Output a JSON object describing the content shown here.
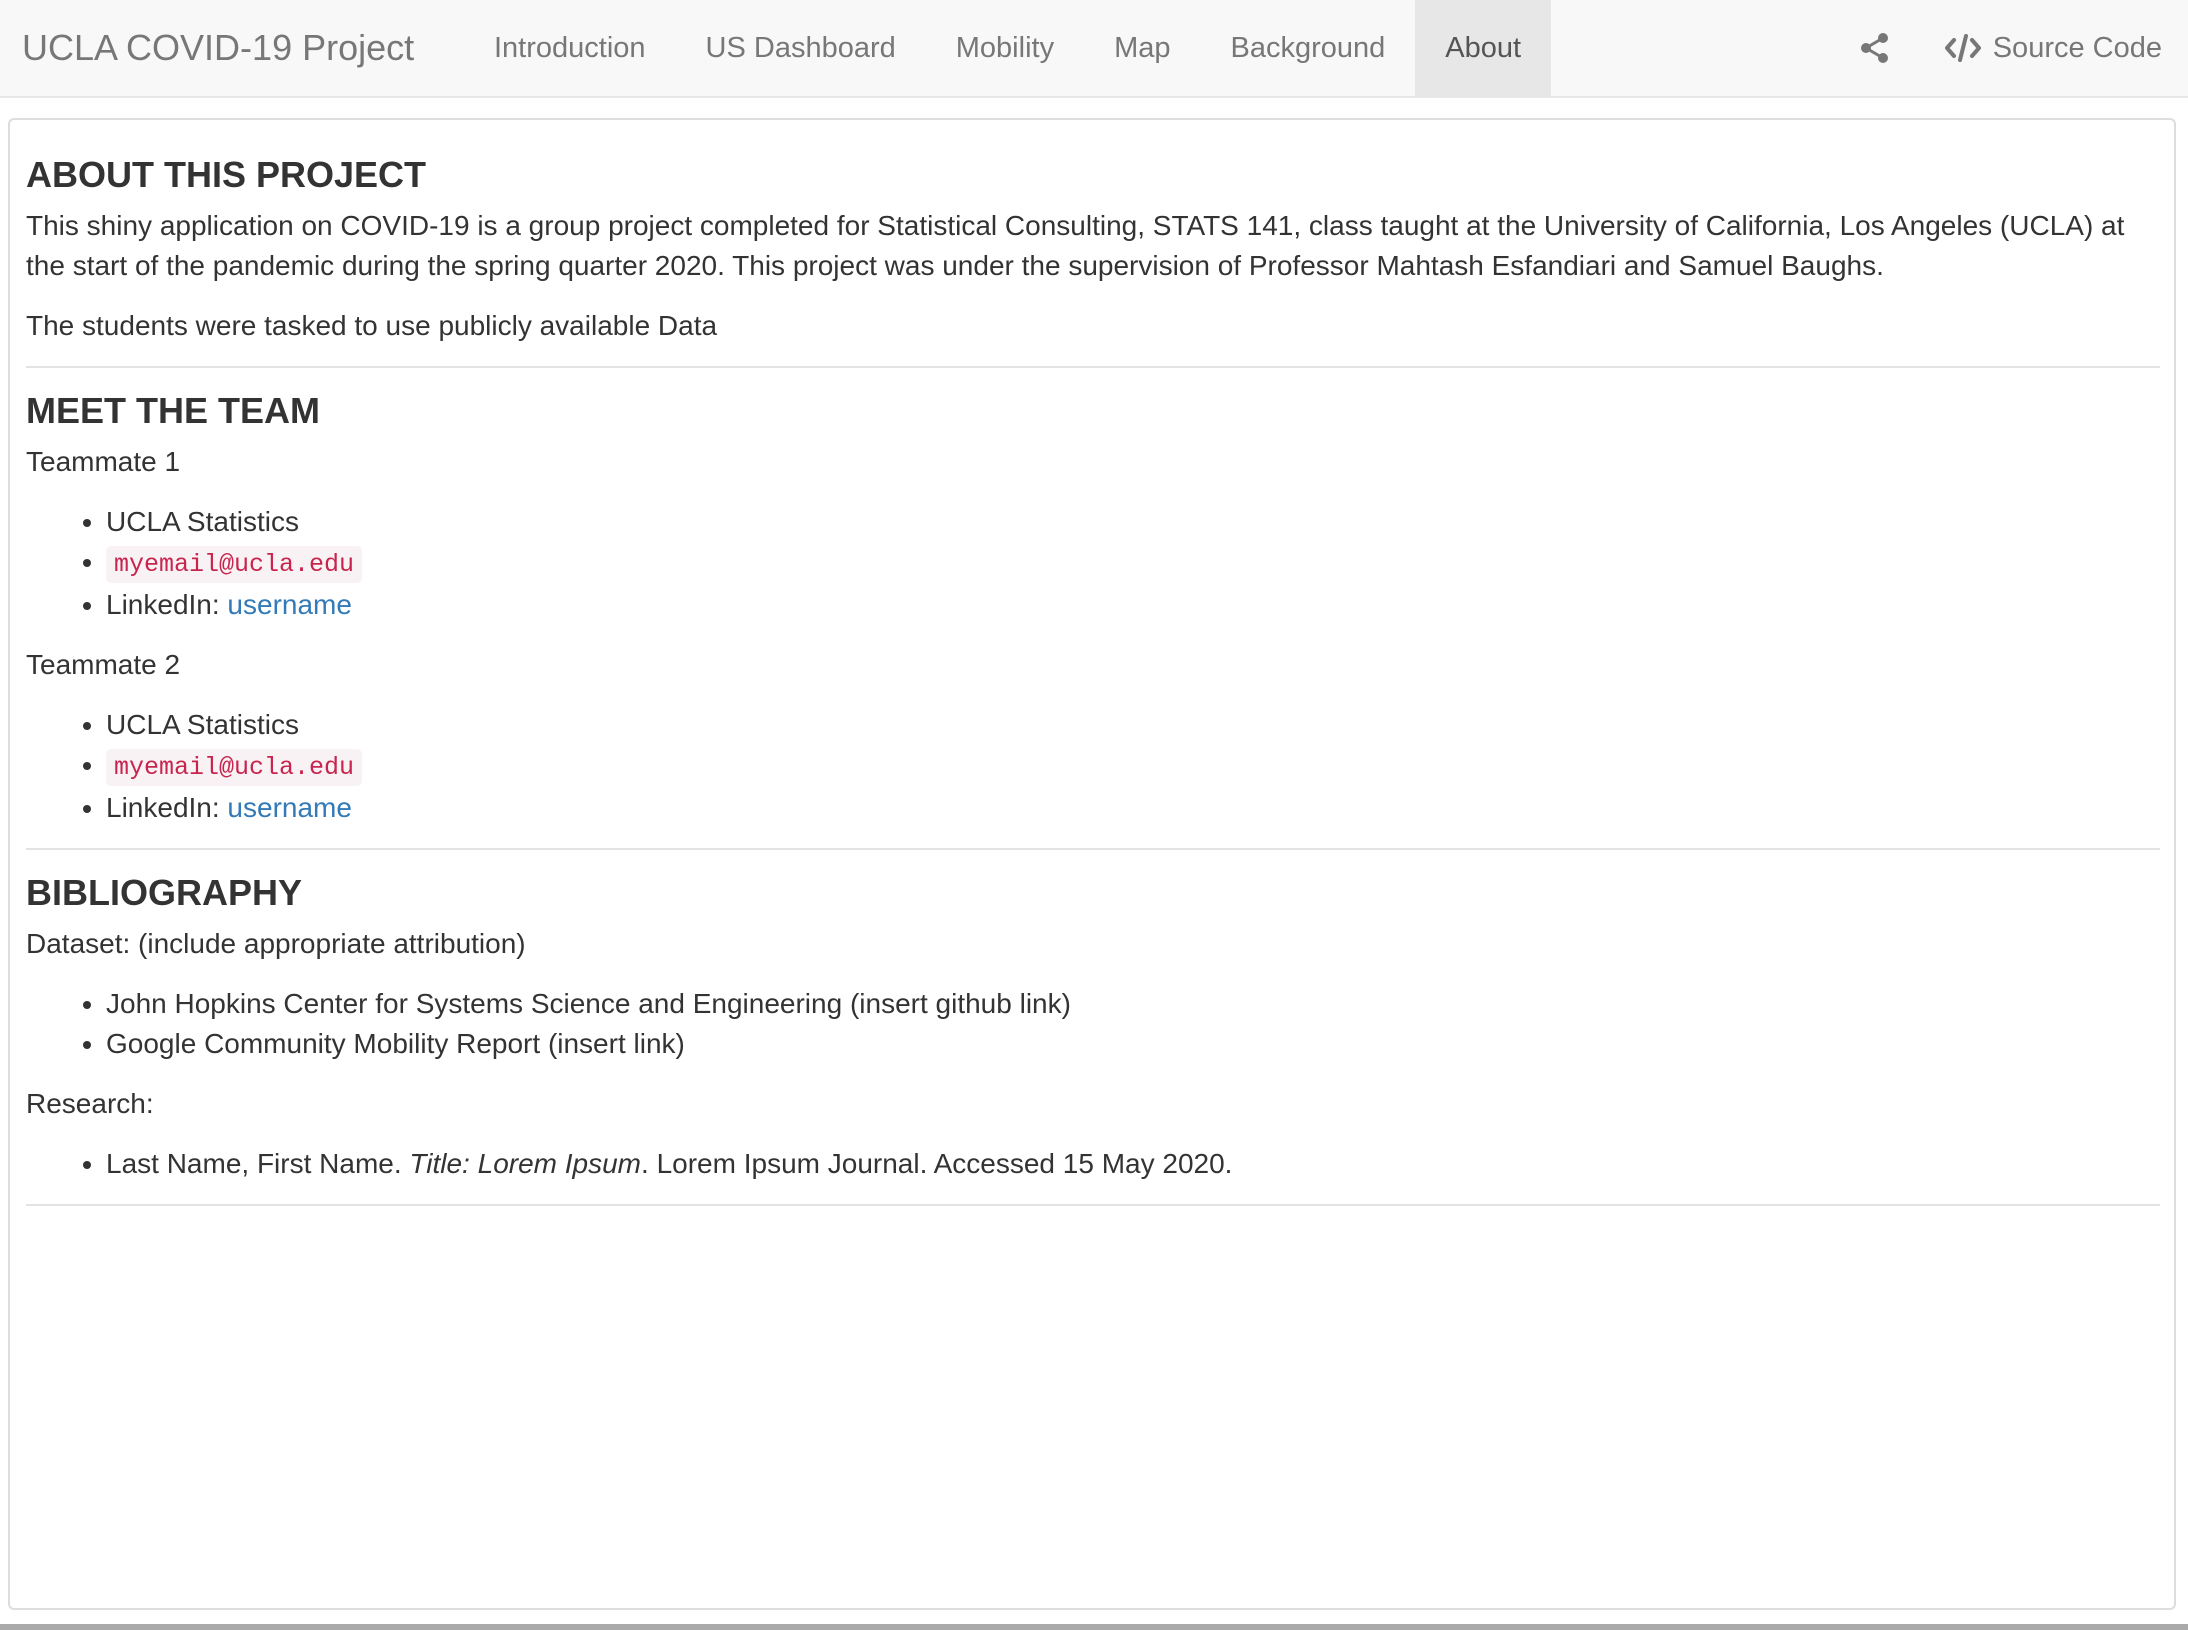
{
  "navbar": {
    "brand": "UCLA COVID-19 Project",
    "tabs": [
      {
        "label": "Introduction"
      },
      {
        "label": "US Dashboard"
      },
      {
        "label": "Mobility"
      },
      {
        "label": "Map"
      },
      {
        "label": "Background"
      },
      {
        "label": "About",
        "active": true
      }
    ],
    "share_icon": "share-icon",
    "source_icon": "code-icon",
    "source_label": "Source Code"
  },
  "about": {
    "heading": "ABOUT THIS PROJECT",
    "paragraph1": "This shiny application on COVID-19 is a group project completed for Statistical Consulting, STATS 141, class taught at the University of California, Los Angeles (UCLA) at the start of the pandemic during the spring quarter 2020. This project was under the supervision of Professor Mahtash Esfandiari and Samuel Baughs.",
    "paragraph2": "The students were tasked to use publicly available Data"
  },
  "team": {
    "heading": "MEET THE TEAM",
    "members": [
      {
        "name": "Teammate 1",
        "department": "UCLA Statistics",
        "email": "myemail@ucla.edu",
        "linkedin_prefix": "LinkedIn: ",
        "linkedin_text": "username"
      },
      {
        "name": "Teammate 2",
        "department": "UCLA Statistics",
        "email": "myemail@ucla.edu",
        "linkedin_prefix": "LinkedIn: ",
        "linkedin_text": "username"
      }
    ]
  },
  "bibliography": {
    "heading": "BIBLIOGRAPHY",
    "dataset_label": "Dataset: (include appropriate attribution)",
    "datasets": [
      "John Hopkins Center for Systems Science and Engineering (insert github link)",
      "Google Community Mobility Report (insert link)"
    ],
    "research_label": "Research:",
    "research": [
      {
        "prefix": "Last Name, First Name. ",
        "title": "Title: Lorem Ipsum",
        "suffix": ". Lorem Ipsum Journal. Accessed 15 May 2020."
      }
    ]
  },
  "colors": {
    "navbar_bg": "#f8f8f8",
    "active_tab_bg": "#e7e7e7",
    "link": "#337ab7",
    "code_text": "#c7254e",
    "code_bg": "#f9f2f4"
  }
}
